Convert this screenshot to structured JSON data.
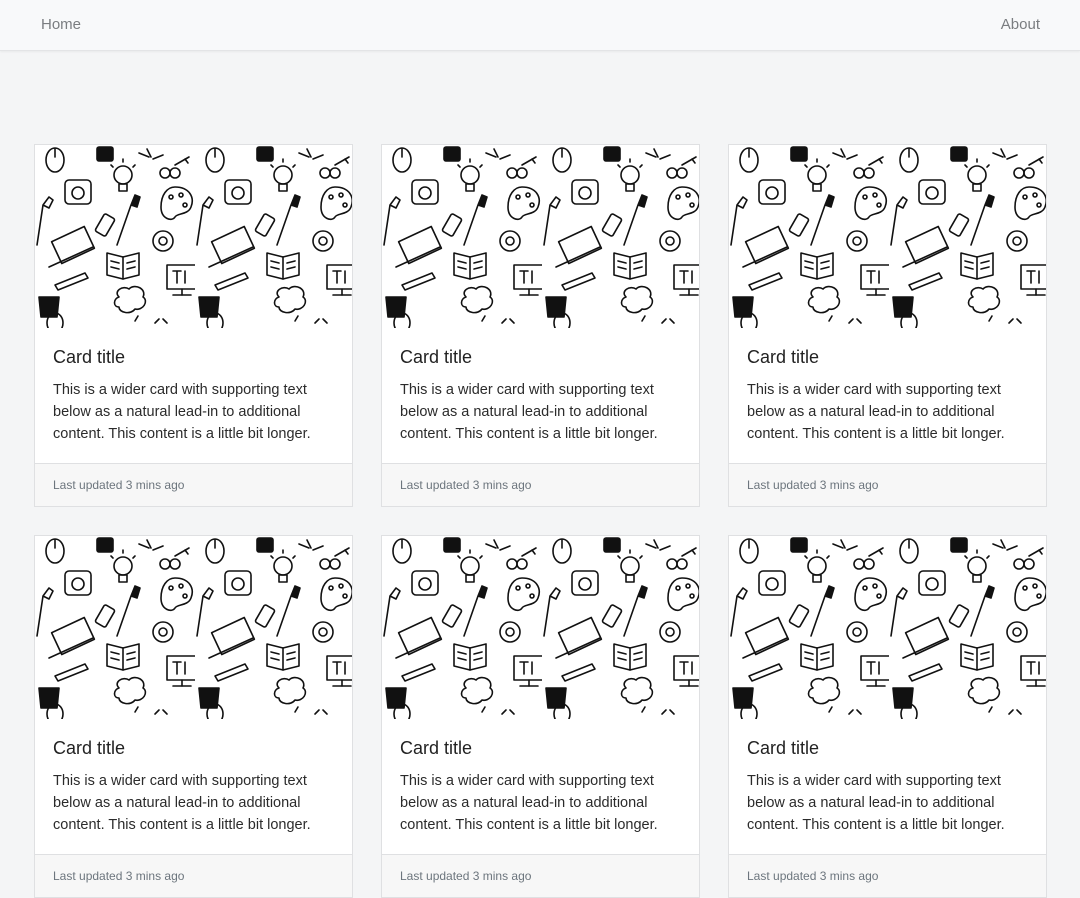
{
  "nav": {
    "home_label": "Home",
    "about_label": "About"
  },
  "cards": [
    {
      "title": "Card title",
      "text": "This is a wider card with supporting text below as a natural lead-in to additional content. This content is a little bit longer.",
      "footer": "Last updated 3 mins ago",
      "image_icon": "doodle-pattern-icon"
    },
    {
      "title": "Card title",
      "text": "This is a wider card with supporting text below as a natural lead-in to additional content. This content is a little bit longer.",
      "footer": "Last updated 3 mins ago",
      "image_icon": "doodle-pattern-icon"
    },
    {
      "title": "Card title",
      "text": "This is a wider card with supporting text below as a natural lead-in to additional content. This content is a little bit longer.",
      "footer": "Last updated 3 mins ago",
      "image_icon": "doodle-pattern-icon"
    },
    {
      "title": "Card title",
      "text": "This is a wider card with supporting text below as a natural lead-in to additional content. This content is a little bit longer.",
      "footer": "Last updated 3 mins ago",
      "image_icon": "doodle-pattern-icon"
    },
    {
      "title": "Card title",
      "text": "This is a wider card with supporting text below as a natural lead-in to additional content. This content is a little bit longer.",
      "footer": "Last updated 3 mins ago",
      "image_icon": "doodle-pattern-icon"
    },
    {
      "title": "Card title",
      "text": "This is a wider card with supporting text below as a natural lead-in to additional content. This content is a little bit longer.",
      "footer": "Last updated 3 mins ago",
      "image_icon": "doodle-pattern-icon"
    }
  ],
  "colors": {
    "page_bg": "#f4f5f6",
    "navbar_bg": "#f8f9fa",
    "nav_link": "#7a7d80",
    "footer_bg": "#f7f7f7"
  }
}
